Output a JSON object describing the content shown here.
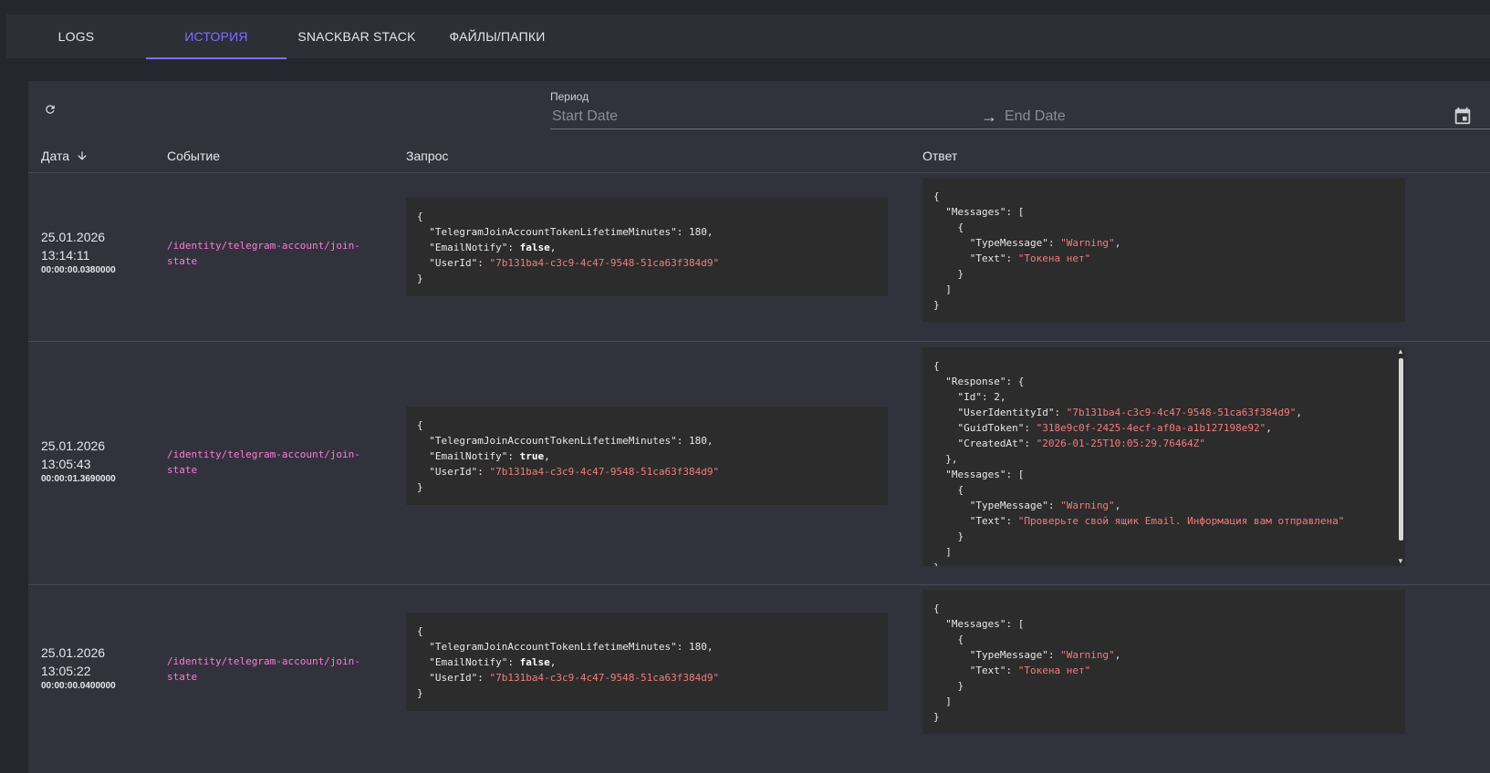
{
  "tabs": [
    {
      "label": "LOGS",
      "active": false
    },
    {
      "label": "ИСТОРИЯ",
      "active": true
    },
    {
      "label": "SNACKBAR STACK",
      "active": false
    },
    {
      "label": "ФАЙЛЫ/ПАПКИ",
      "active": false
    }
  ],
  "toolbar": {
    "refresh_icon": "refresh-icon",
    "period_label": "Период",
    "start_placeholder": "Start Date",
    "end_placeholder": "End Date",
    "arrow": "→",
    "calendar_icon": "calendar-icon"
  },
  "table": {
    "columns": {
      "date": "Дата",
      "event": "Событие",
      "request": "Запрос",
      "response": "Ответ"
    },
    "sort_icon": "arrow-down-icon",
    "rows": [
      {
        "date": "25.01.2026",
        "time": "13:14:11",
        "duration": "00:00:00.0380000",
        "event": "/identity/telegram-account/join-state",
        "request": {
          "TelegramJoinAccountTokenLifetimeMinutes": 180,
          "EmailNotify": false,
          "UserId": "7b131ba4-c3c9-4c47-9548-51ca63f384d9"
        },
        "response": {
          "Messages": [
            {
              "TypeMessage": "Warning",
              "Text": "Токена нет"
            }
          ]
        }
      },
      {
        "date": "25.01.2026",
        "time": "13:05:43",
        "duration": "00:00:01.3690000",
        "event": "/identity/telegram-account/join-state",
        "request": {
          "TelegramJoinAccountTokenLifetimeMinutes": 180,
          "EmailNotify": true,
          "UserId": "7b131ba4-c3c9-4c47-9548-51ca63f384d9"
        },
        "response": {
          "Response": {
            "Id": 2,
            "UserIdentityId": "7b131ba4-c3c9-4c47-9548-51ca63f384d9",
            "GuidToken": "318e9c0f-2425-4ecf-af0a-a1b127198e92",
            "CreatedAt": "2026-01-25T10:05:29.76464Z"
          },
          "Messages": [
            {
              "TypeMessage": "Warning",
              "Text": "Проверьте свой ящик Email. Информация вам отправлена"
            }
          ]
        }
      },
      {
        "date": "25.01.2026",
        "time": "13:05:22",
        "duration": "00:00:00.0400000",
        "event": "/identity/telegram-account/join-state",
        "request": {
          "TelegramJoinAccountTokenLifetimeMinutes": 180,
          "EmailNotify": false,
          "UserId": "7b131ba4-c3c9-4c47-9548-51ca63f384d9"
        },
        "response": {
          "Messages": [
            {
              "TypeMessage": "Warning",
              "Text": "Токена нет"
            }
          ]
        }
      }
    ]
  },
  "colors": {
    "accent": "#7e6fff",
    "event_link": "#ff7ad9",
    "json_string": "#f37c7c",
    "code_bg": "#2c2c2c"
  }
}
